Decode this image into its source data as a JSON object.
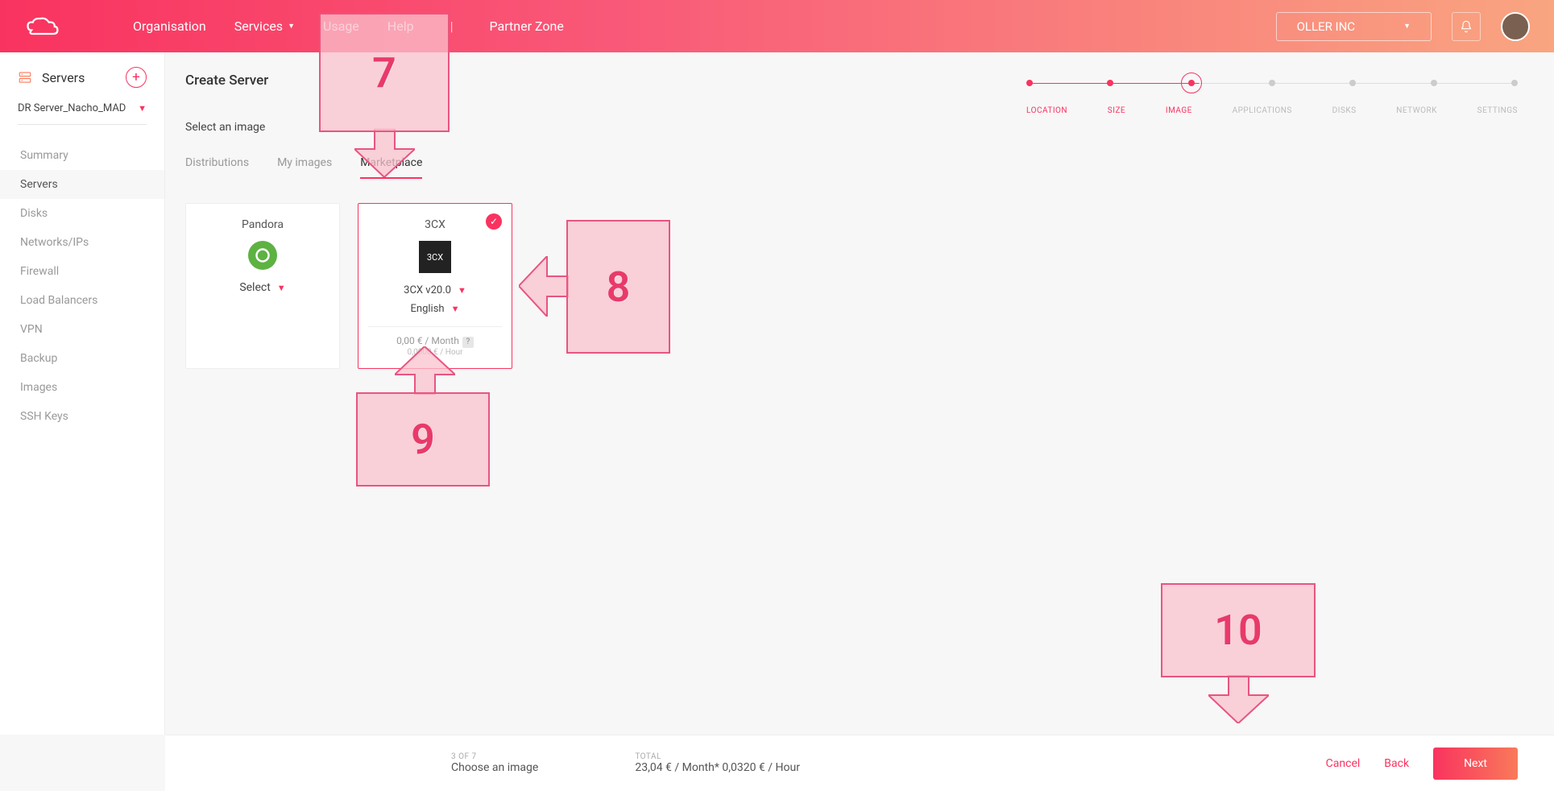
{
  "header": {
    "nav": {
      "organisation": "Organisation",
      "services": "Services",
      "usage": "Usage",
      "help": "Help",
      "partner_zone": "Partner Zone"
    },
    "org_selector": "OLLER INC"
  },
  "sidebar": {
    "title": "Servers",
    "server_dropdown": "DR Server_Nacho_MAD",
    "items": [
      "Summary",
      "Servers",
      "Disks",
      "Networks/IPs",
      "Firewall",
      "Load Balancers",
      "VPN",
      "Backup",
      "Images",
      "SSH Keys"
    ],
    "active_index": 1
  },
  "main": {
    "title": "Create Server",
    "section": "Select an image",
    "tabs": [
      "Distributions",
      "My images",
      "Marketplace"
    ],
    "active_tab": 2,
    "cards": {
      "pandora": {
        "name": "Pandora",
        "action": "Select"
      },
      "cx": {
        "name": "3CX",
        "logo_text": "3CX",
        "version": "3CX v20.0",
        "lang": "English",
        "price_month": "0,00 € / Month",
        "price_hour": "0,0000 € / Hour"
      }
    }
  },
  "wizard": {
    "steps": [
      "LOCATION",
      "SIZE",
      "IMAGE",
      "APPLICATIONS",
      "DISKS",
      "NETWORK",
      "SETTINGS"
    ],
    "current": 2
  },
  "footer": {
    "step_lbl": "3 OF 7",
    "step_title": "Choose an image",
    "total_lbl": "TOTAL",
    "total_val": "23,04 € / Month*   0,0320 € / Hour",
    "cancel": "Cancel",
    "back": "Back",
    "next": "Next"
  },
  "callouts": {
    "c7": "7",
    "c8": "8",
    "c9": "9",
    "c10": "10"
  }
}
